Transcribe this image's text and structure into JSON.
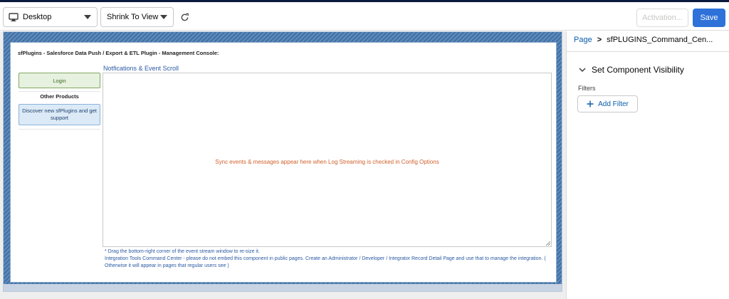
{
  "toolbar": {
    "device": {
      "label": "Desktop",
      "icon": "desktop-icon"
    },
    "zoom": {
      "label": "Shrink To View"
    },
    "refresh_icon": "refresh-icon",
    "activation_label": "Activation...",
    "save_label": "Save"
  },
  "canvas": {
    "console_title": "sfPlugins - Salesforce Data Push / Export & ETL Plugin - Management Console:",
    "sidebar": {
      "login_label": "Login",
      "other_products_heading": "Other Products",
      "discover_label": "Discover new sfPlugins and get support"
    },
    "notifications": {
      "heading": "Notfications & Event Scroll",
      "placeholder_message": "Sync events & messages appear here when Log Streaming is checked in Config Options"
    },
    "notes": {
      "line1": "* Drag the bottom-right corner of the event stream window to re-size it.",
      "line2": "Integration Tools Command Center - please do not embed this component in public pages. Create an Administrator / Developer / Integrator Record Detail Page and use that to manage the integration. ( Otherwise it will appear in pages that regular users see )"
    }
  },
  "properties": {
    "breadcrumb": {
      "root": "Page",
      "separator": ">",
      "current": "sfPLUGINS_Command_Cen..."
    },
    "section_title": "Set Component Visibility",
    "filters_label": "Filters",
    "add_filter_label": "Add Filter"
  },
  "colors": {
    "save_button": "#2e71d8",
    "link": "#0b5cab",
    "notification_message": "#d1602b",
    "frame_blue": "#3f72a8"
  }
}
